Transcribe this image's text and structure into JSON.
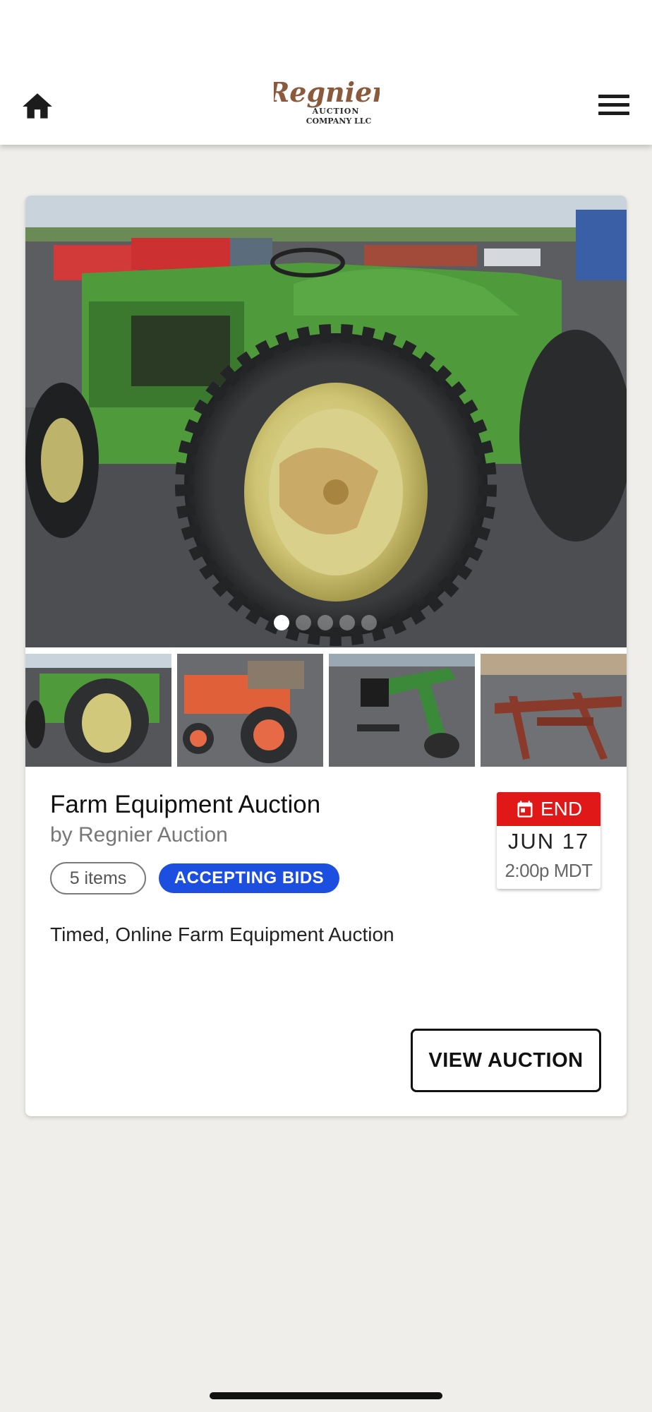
{
  "header": {
    "logo_name": "Regnier",
    "logo_sub1": "AUCTION",
    "logo_sub2": "COMPANY LLC",
    "home_icon": "home-icon",
    "menu_icon": "hamburger-menu-icon"
  },
  "auction": {
    "title": "Farm Equipment Auction",
    "byline": "by Regnier Auction",
    "items_badge": "5 items",
    "status_badge": "ACCEPTING BIDS",
    "description": "Timed, Online Farm Equipment Auction",
    "date_label": "END",
    "date_day": "JUN 17",
    "date_time": "2:00p MDT",
    "view_button": "VIEW AUCTION",
    "carousel": {
      "total_slides": 5,
      "active_slide": 1
    },
    "thumbnails": [
      "green tractor",
      "orange tractor",
      "green backhoe attachment",
      "rusty equipment frame"
    ]
  },
  "colors": {
    "status_blue": "#1c4fe0",
    "end_red": "#e01818",
    "logo_brown": "#8b5a3c",
    "background": "#efeeea"
  }
}
